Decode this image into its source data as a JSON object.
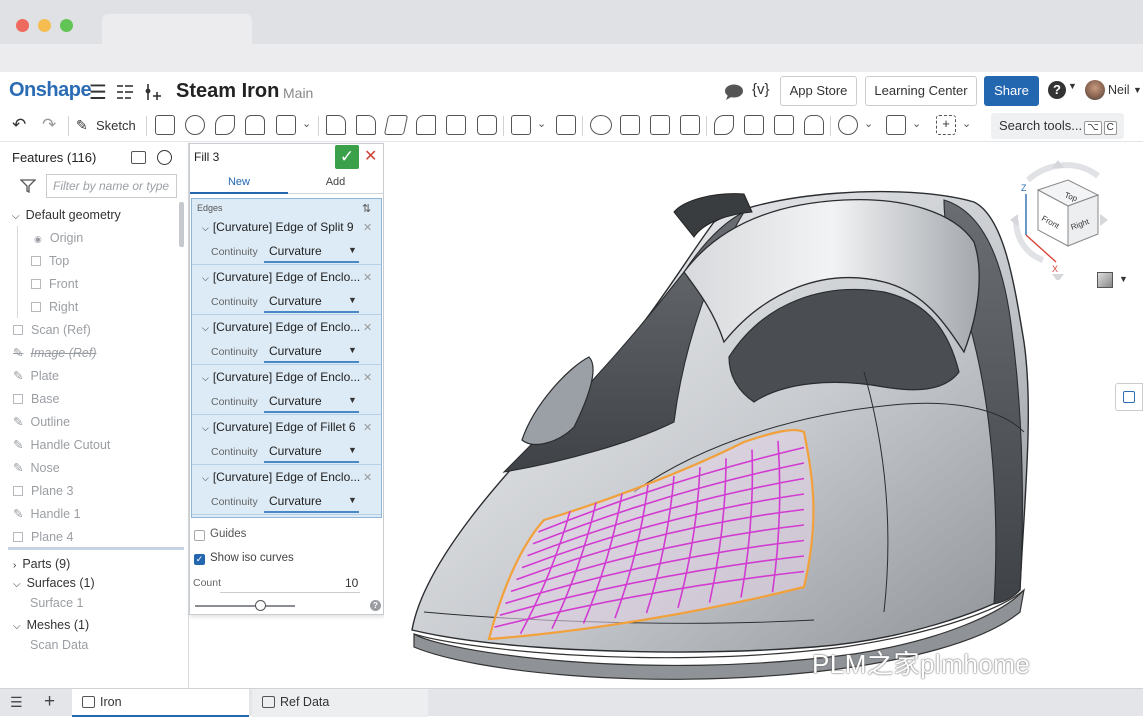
{
  "window": {
    "tab_title": ""
  },
  "header": {
    "logo": "Onshape",
    "document_title": "Steam Iron",
    "branch": "Main",
    "app_store": "App Store",
    "learning_center": "Learning Center",
    "share": "Share",
    "user": "Neil",
    "help_glyph": "?",
    "variables_glyph": "{v}"
  },
  "toolbar": {
    "sketch_label": "Sketch",
    "search_tools": "Search tools...",
    "search_shortcut": [
      "⌥",
      "C"
    ]
  },
  "feature_panel": {
    "title": "Features (116)",
    "filter_placeholder": "Filter by name or type",
    "default_geometry": "Default geometry",
    "planes": [
      "Origin",
      "Top",
      "Front",
      "Right"
    ],
    "features": [
      "Scan (Ref)",
      "Image (Ref)",
      "Plate",
      "Base",
      "Outline",
      "Handle Cutout",
      "Nose",
      "Plane 3",
      "Handle 1",
      "Plane 4"
    ],
    "parts": "Parts (9)",
    "surfaces": "Surfaces (1)",
    "surface_items": [
      "Surface 1"
    ],
    "meshes": "Meshes (1)",
    "mesh_items": [
      "Scan Data"
    ]
  },
  "fill_dialog": {
    "title": "Fill 3",
    "tab_new": "New",
    "tab_add": "Add",
    "edges_header": "Edges",
    "continuity_label": "Continuity",
    "edges": [
      {
        "label": "[Curvature] Edge of Split 9",
        "continuity": "Curvature"
      },
      {
        "label": "[Curvature] Edge of Enclo...",
        "continuity": "Curvature"
      },
      {
        "label": "[Curvature] Edge of Enclo...",
        "continuity": "Curvature"
      },
      {
        "label": "[Curvature] Edge of Enclo...",
        "continuity": "Curvature"
      },
      {
        "label": "[Curvature] Edge of Fillet 6",
        "continuity": "Curvature"
      },
      {
        "label": "[Curvature] Edge of Enclo...",
        "continuity": "Curvature"
      }
    ],
    "guides_label": "Guides",
    "guides_checked": false,
    "show_iso_label": "Show iso curves",
    "show_iso_checked": true,
    "count_label": "Count",
    "count_value": "10",
    "slider_fraction": 0.65
  },
  "view_cube": {
    "top": "Top",
    "front": "Front",
    "right": "Right",
    "axis_z": "Z",
    "axis_x": "X"
  },
  "bottom_tabs": {
    "iron": "Iron",
    "ref_data": "Ref Data"
  },
  "watermark": "PLM之家plmhome",
  "colors": {
    "accent": "#2467b1",
    "ok_green": "#3aa14a",
    "close_red": "#d0443a",
    "iso_magenta": "#d23bd2",
    "edge_orange": "#f2a13a",
    "edge_panel": "#ddebf6"
  }
}
